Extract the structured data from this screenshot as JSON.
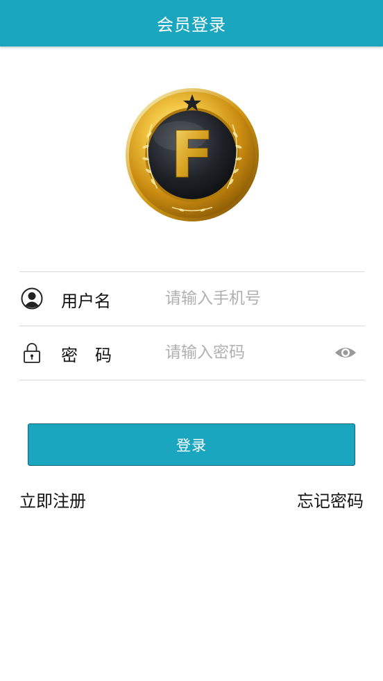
{
  "header": {
    "title": "会员登录"
  },
  "logo": {
    "letter": "F",
    "icon": "gold-medal-logo"
  },
  "form": {
    "username": {
      "icon": "user-icon",
      "label": "用户名",
      "placeholder": "请输入手机号",
      "value": ""
    },
    "password": {
      "icon": "lock-icon",
      "label": "密码",
      "placeholder": "请输入密码",
      "value": "",
      "toggle_icon": "eye-icon"
    }
  },
  "actions": {
    "login_label": "登录",
    "register_label": "立即注册",
    "forgot_label": "忘记密码"
  },
  "colors": {
    "primary": "#1ba6c0",
    "gold": "#d9a421",
    "divider": "#d9d9d9",
    "placeholder": "#b0b0b0"
  }
}
